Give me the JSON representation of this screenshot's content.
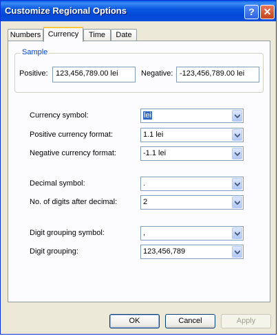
{
  "window": {
    "title": "Customize Regional Options",
    "help_label": "?",
    "close_label": "✕"
  },
  "tabs": [
    {
      "label": "Numbers"
    },
    {
      "label": "Currency"
    },
    {
      "label": "Time"
    },
    {
      "label": "Date"
    }
  ],
  "sample": {
    "group_label": "Sample",
    "positive_label": "Positive:",
    "positive_value": "123,456,789.00 lei",
    "negative_label": "Negative:",
    "negative_value": "-123,456,789.00 lei"
  },
  "fields": [
    {
      "label": "Currency symbol:",
      "value": "lei"
    },
    {
      "label": "Positive currency format:",
      "value": "1.1 lei"
    },
    {
      "label": "Negative currency format:",
      "value": "-1.1 lei"
    },
    {
      "label": "Decimal symbol:",
      "value": "."
    },
    {
      "label": "No. of digits after decimal:",
      "value": "2"
    },
    {
      "label": "Digit grouping symbol:",
      "value": ","
    },
    {
      "label": "Digit grouping:",
      "value": "123,456,789"
    }
  ],
  "buttons": {
    "ok": "OK",
    "cancel": "Cancel",
    "apply": "Apply"
  }
}
